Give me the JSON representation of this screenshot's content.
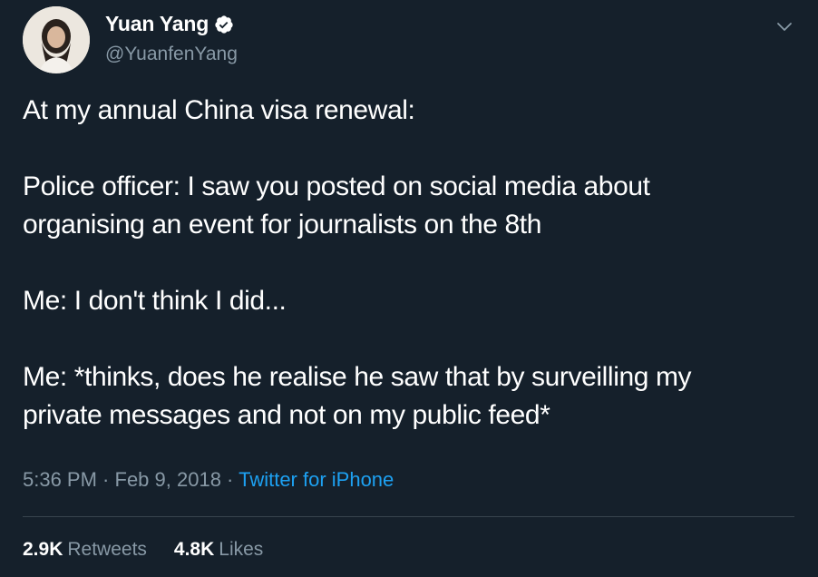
{
  "author": {
    "display_name": "Yuan Yang",
    "handle": "@YuanfenYang",
    "verified": true,
    "avatar_icon": "profile-photo"
  },
  "tweet": {
    "paragraphs": [
      "At my annual China visa renewal:",
      "Police officer: I saw you posted on social media about\norganising an event for journalists on the 8th",
      "Me: I don't think I did...",
      "Me: *thinks, does he realise he saw that by surveilling my\nprivate messages and not on my public feed*"
    ],
    "time": "5:36 PM",
    "separator": " · ",
    "date": "Feb 9, 2018",
    "source": "Twitter for iPhone"
  },
  "stats": {
    "retweets_count": "2.9K",
    "retweets_label": "Retweets",
    "likes_count": "4.8K",
    "likes_label": "Likes"
  },
  "colors": {
    "background": "#15202b",
    "text": "#ffffff",
    "secondary": "#8899a6",
    "accent": "#1da1f2",
    "divider": "#38444d"
  },
  "icons": {
    "verified": "verified-badge-icon",
    "caret": "chevron-down-icon"
  }
}
